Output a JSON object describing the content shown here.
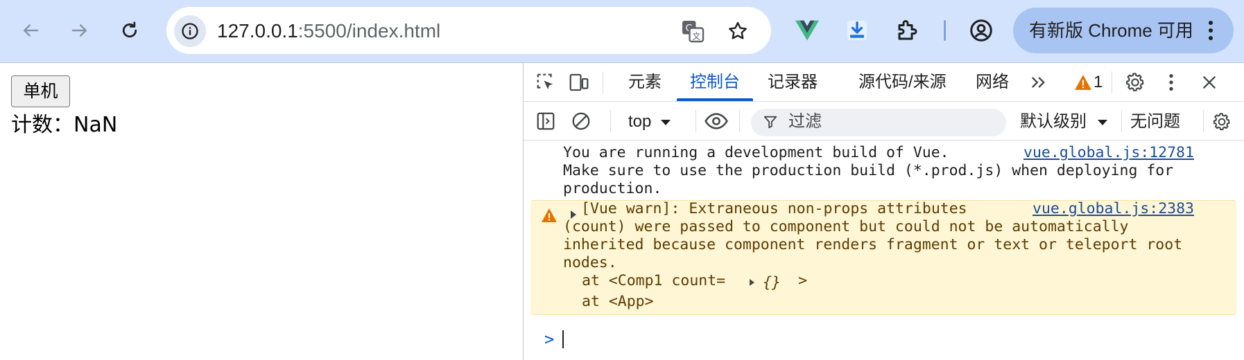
{
  "browser": {
    "url_host": "127.0.0.1",
    "url_rest": ":5500/index.html",
    "update_label": "有新版 Chrome 可用",
    "icons": [
      "back-icon",
      "forward-icon",
      "reload-icon",
      "site-info-icon",
      "translate-icon",
      "bookmark-star-icon",
      "vue-devtools-icon",
      "download-icon",
      "extensions-icon",
      "profile-icon",
      "menu-icon"
    ]
  },
  "page": {
    "button_label": "单机",
    "count_label": "计数：NaN"
  },
  "devtools": {
    "tabs": [
      "元素",
      "控制台",
      "记录器",
      "源代码/来源",
      "网络"
    ],
    "active_tab": "控制台",
    "more_tabs_label": "»",
    "warning_count": "1",
    "context": "top",
    "filter_placeholder": "过滤",
    "level": "默认级别",
    "issues": "无问题"
  },
  "console": {
    "messages": [
      {
        "type": "log",
        "text": "You are running a development build of Vue.\nMake sure to use the production build (*.prod.js) when deploying for\nproduction.",
        "source": "vue.global.js:12781"
      },
      {
        "type": "warning",
        "text": "[Vue warn]: Extraneous non-props attributes\n(count) were passed to component but could not be automatically\ninherited because component renders fragment or text or teleport root\nnodes.",
        "source": "vue.global.js:2383",
        "stack": [
          "at <Comp1 count=",
          "{}",
          ">",
          "at <App>"
        ]
      }
    ],
    "prompt_symbol": ">"
  },
  "colors": {
    "toolbar_bg": "#d3e3fd",
    "accent": "#0b57d0",
    "warning_bg": "#fef6d5",
    "warning_icon": "#e37400",
    "link": "#1a4e96"
  }
}
